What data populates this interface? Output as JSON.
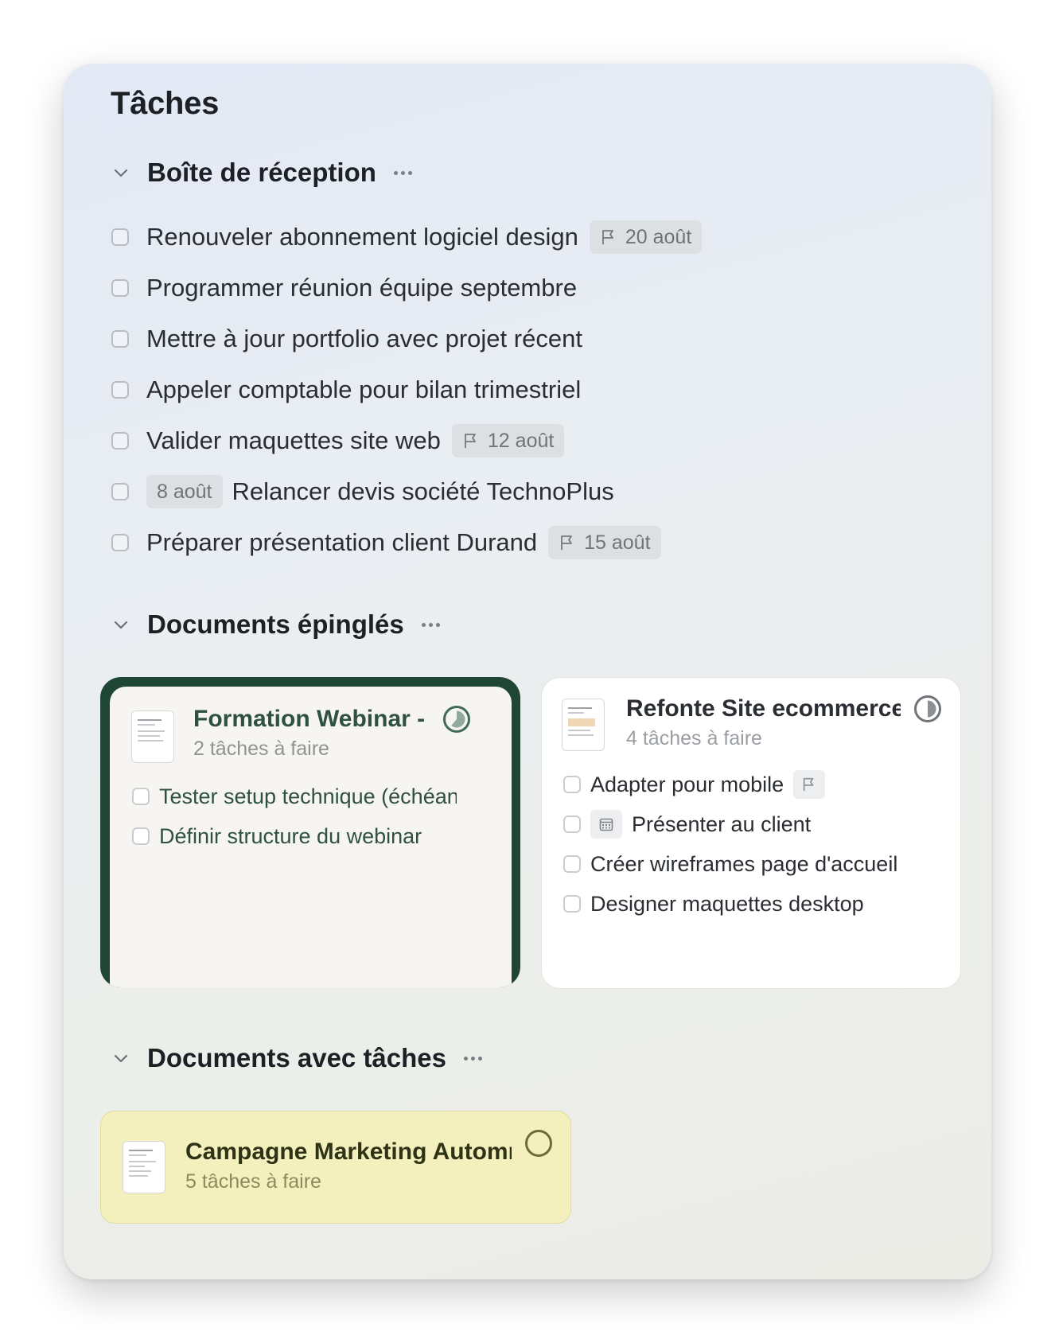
{
  "page": {
    "title": "Tâches"
  },
  "inbox": {
    "title": "Boîte de réception",
    "tasks": [
      {
        "text": "Renouveler abonnement logiciel design",
        "chip": "20 août",
        "chip_icon": "flag-icon"
      },
      {
        "text": "Programmer réunion équipe septembre"
      },
      {
        "text": "Mettre à jour portfolio avec projet récent"
      },
      {
        "text": "Appeler comptable pour bilan trimestriel"
      },
      {
        "text": "Valider maquettes site web",
        "chip": "12 août",
        "chip_icon": "flag-icon"
      },
      {
        "text": "Relancer devis société TechnoPlus",
        "prefix_chip": "8 août"
      },
      {
        "text": "Préparer présentation client Durand",
        "chip": "15 août",
        "chip_icon": "flag-icon"
      }
    ]
  },
  "pinned": {
    "title": "Documents épinglés",
    "cards": [
      {
        "title": "Formation Webinar - Outils",
        "subtitle": "2 tâches à faire",
        "accent": "#1f4534",
        "tasks": [
          {
            "text": "Tester setup technique (échéance"
          },
          {
            "text": "Définir structure du webinar"
          }
        ]
      },
      {
        "title": "Refonte Site ecommerce - Client",
        "subtitle": "4 tâches à faire",
        "tasks": [
          {
            "text": "Adapter pour mobile",
            "icon": "flag-icon"
          },
          {
            "text": "Présenter au client",
            "prefix_icon": "calendar-icon"
          },
          {
            "text": "Créer wireframes page d'accueil"
          },
          {
            "text": "Designer maquettes desktop"
          }
        ]
      }
    ]
  },
  "with_tasks": {
    "title": "Documents avec tâches",
    "cards": [
      {
        "title": "Campagne Marketing Automne",
        "subtitle": "5 tâches à faire",
        "color": "#f3f0be"
      }
    ]
  }
}
